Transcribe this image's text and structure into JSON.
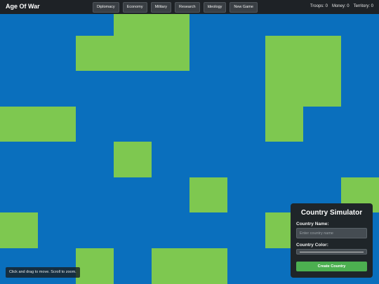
{
  "app": {
    "title": "Age Of War"
  },
  "nav": {
    "items": [
      {
        "label": "Diplomacy"
      },
      {
        "label": "Economy"
      },
      {
        "label": "Military"
      },
      {
        "label": "Research"
      },
      {
        "label": "Ideology"
      },
      {
        "label": "New Game"
      }
    ]
  },
  "stats": {
    "troops": "Troops: 0",
    "money": "Money: 0",
    "territory": "Territory: 0"
  },
  "map": {
    "hint": "Click and drag to move. Scroll to zoom.",
    "colors": {
      "water": "#0a6fbd",
      "land": "#7ec850"
    }
  },
  "panel": {
    "title": "Country Simulator",
    "name_label": "Country Name:",
    "name_placeholder": "Enter country name",
    "name_value": "",
    "color_label": "Country Color:",
    "create_label": "Create Country",
    "accent": "#4caf50"
  }
}
